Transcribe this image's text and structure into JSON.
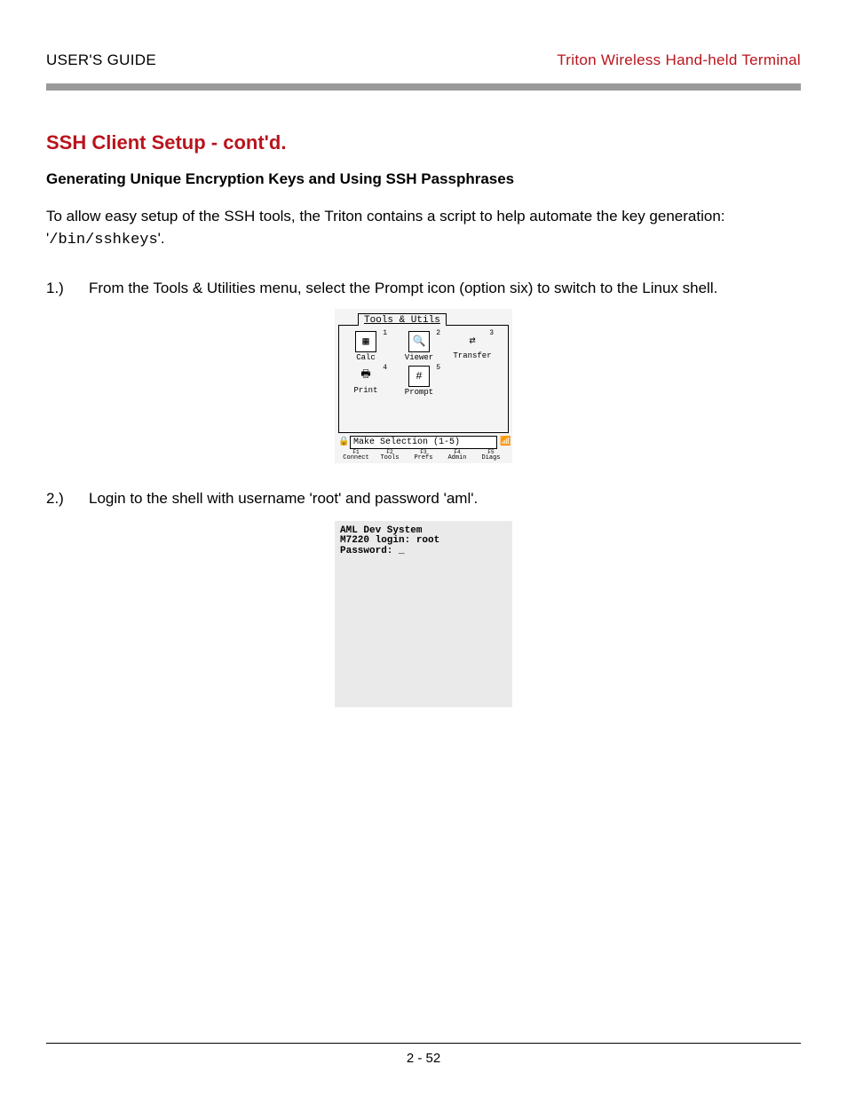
{
  "header": {
    "left": "USER'S GUIDE",
    "right": "Triton Wireless Hand-held Terminal"
  },
  "section_title": "SSH Client Setup - cont'd.",
  "subheading": "Generating Unique Encryption Keys and Using SSH Passphrases",
  "intro": {
    "pre": "To allow easy setup of the SSH tools, the Triton contains a script to help automate the key generation: '",
    "code": "/bin/sshkeys",
    "post": "'."
  },
  "steps": [
    {
      "num": "1.)",
      "text": "From the Tools & Utilities menu, select the Prompt icon (option six) to switch to the Linux shell."
    },
    {
      "num": "2.)",
      "text": "Login to the shell with username 'root' and password 'aml'."
    }
  ],
  "shot1": {
    "tab": "Tools & Utils",
    "items": [
      {
        "n": "1",
        "label": "Calc",
        "glyph": "▦"
      },
      {
        "n": "2",
        "label": "Viewer",
        "glyph": "🔍"
      },
      {
        "n": "3",
        "label": "Transfer",
        "glyph": "⇄"
      },
      {
        "n": "4",
        "label": "Print",
        "glyph": "🖶"
      },
      {
        "n": "5",
        "label": "Prompt",
        "glyph": "#"
      }
    ],
    "status": "Make Selection (1-5)",
    "fkeys": [
      {
        "f": "F1",
        "label": "Connect"
      },
      {
        "f": "F2",
        "label": "Tools"
      },
      {
        "f": "F3",
        "label": "Prefs"
      },
      {
        "f": "F4",
        "label": "Admin"
      },
      {
        "f": "F5",
        "label": "Diags"
      }
    ]
  },
  "shot2": {
    "line1": "AML Dev System",
    "line2": "M7220 login: root",
    "line3": "Password: _"
  },
  "footer": "2 - 52"
}
